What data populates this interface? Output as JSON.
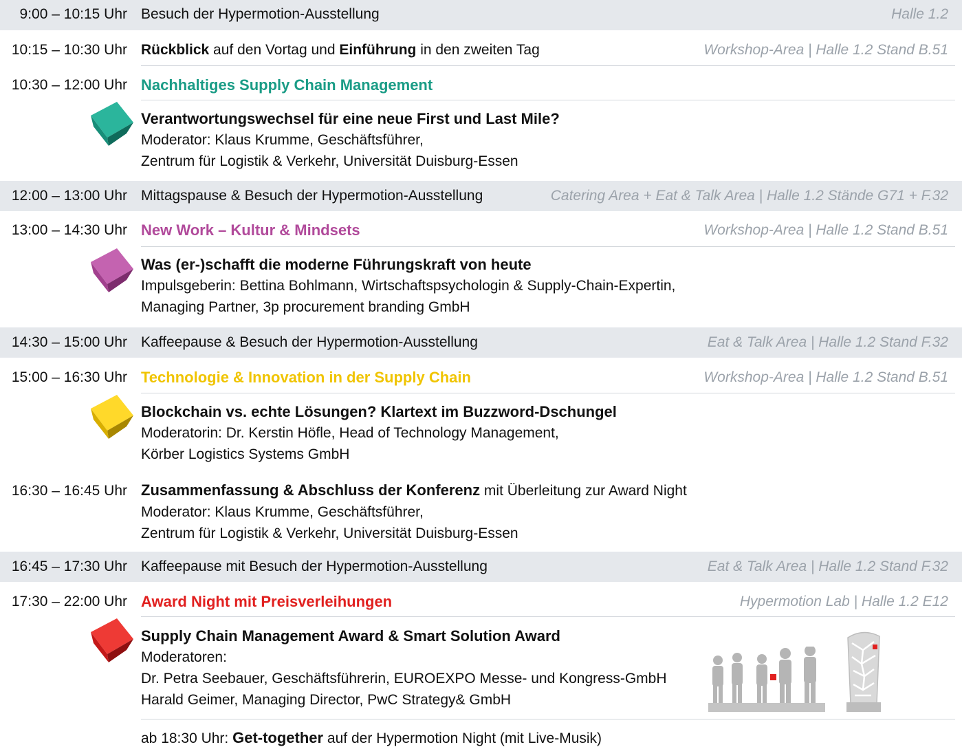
{
  "schedule": {
    "s1": {
      "time": "9:00 – 10:15 Uhr",
      "desc": "Besuch der Hypermotion-Ausstellung",
      "loc": "Halle 1.2"
    },
    "s2": {
      "time": "10:15 – 10:30 Uhr",
      "b1": "Rückblick",
      "t1": " auf den Vortag und ",
      "b2": "Einführung",
      "t2": " in den zweiten Tag",
      "loc": "Workshop-Area | Halle 1.2 Stand B.51"
    },
    "s3": {
      "time": "10:30 – 12:00 Uhr",
      "title": "Nachhaltiges Supply Chain Management",
      "subtitle": "Verantwortungswechsel für eine neue First und Last Mile?",
      "line1": "Moderator: Klaus Krumme, Geschäftsführer,",
      "line2": "Zentrum für Logistik & Verkehr, Universität Duisburg-Essen"
    },
    "s4": {
      "time": "12:00 – 13:00 Uhr",
      "desc": "Mittagspause & Besuch der Hypermotion-Ausstellung",
      "loc": "Catering Area + Eat & Talk Area | Halle 1.2 Stände G71 + F.32"
    },
    "s5": {
      "time": "13:00 – 14:30 Uhr",
      "title": "New Work – Kultur & Mindsets",
      "loc": "Workshop-Area | Halle 1.2 Stand B.51",
      "subtitle": "Was (er-)schafft die moderne Führungskraft von heute",
      "line1": "Impulsgeberin: Bettina Bohlmann, Wirtschaftspsychologin & Supply-Chain-Expertin,",
      "line2": "Managing Partner, 3p procurement branding GmbH"
    },
    "s6": {
      "time": "14:30 – 15:00 Uhr",
      "desc": "Kaffeepause & Besuch der Hypermotion-Ausstellung",
      "loc": "Eat & Talk Area | Halle 1.2 Stand F.32"
    },
    "s7": {
      "time": "15:00 – 16:30 Uhr",
      "title": "Technologie & Innovation in der Supply Chain",
      "loc": "Workshop-Area | Halle 1.2 Stand B.51",
      "subtitle": "Blockchain vs. echte Lösungen? Klartext im Buzzword-Dschungel",
      "line1": "Moderatorin: Dr. Kerstin Höfle, Head of Technology Management,",
      "line2": "Körber Logistics Systems GmbH"
    },
    "s8": {
      "time": "16:30 – 16:45 Uhr",
      "b1": "Zusammenfassung & Abschluss der Konferenz",
      "t1": " mit Überleitung zur Award Night",
      "line1": "Moderator: Klaus Krumme, Geschäftsführer,",
      "line2": "Zentrum für Logistik & Verkehr, Universität Duisburg-Essen"
    },
    "s9": {
      "time": "16:45 – 17:30 Uhr",
      "desc": "Kaffeepause mit Besuch der Hypermotion-Ausstellung",
      "loc": "Eat & Talk Area | Halle 1.2 Stand F.32"
    },
    "s10": {
      "time": "17:30 – 22:00 Uhr",
      "title": "Award Night mit Preisverleihungen",
      "loc": "Hypermotion Lab | Halle 1.2 E12",
      "subtitle": "Supply Chain Management Award & Smart Solution Award",
      "line1": "Moderatoren:",
      "line2": "Dr. Petra Seebauer, Geschäftsführerin, EUROEXPO Messe- und Kongress-GmbH",
      "line3": "Harald Geimer, Managing Director, PwC Strategy& GmbH"
    },
    "s11": {
      "t1": "ab 18:30 Uhr: ",
      "b1": "Get-together",
      "t2": " auf der Hypermotion Night (mit Live-Musik)"
    }
  },
  "colors": {
    "teal": "#1a9c86",
    "magenta": "#b14a9b",
    "yellow": "#f0c400",
    "red": "#e1201f",
    "shade": "#e5e8ec",
    "loc": "#9ba2aa"
  }
}
